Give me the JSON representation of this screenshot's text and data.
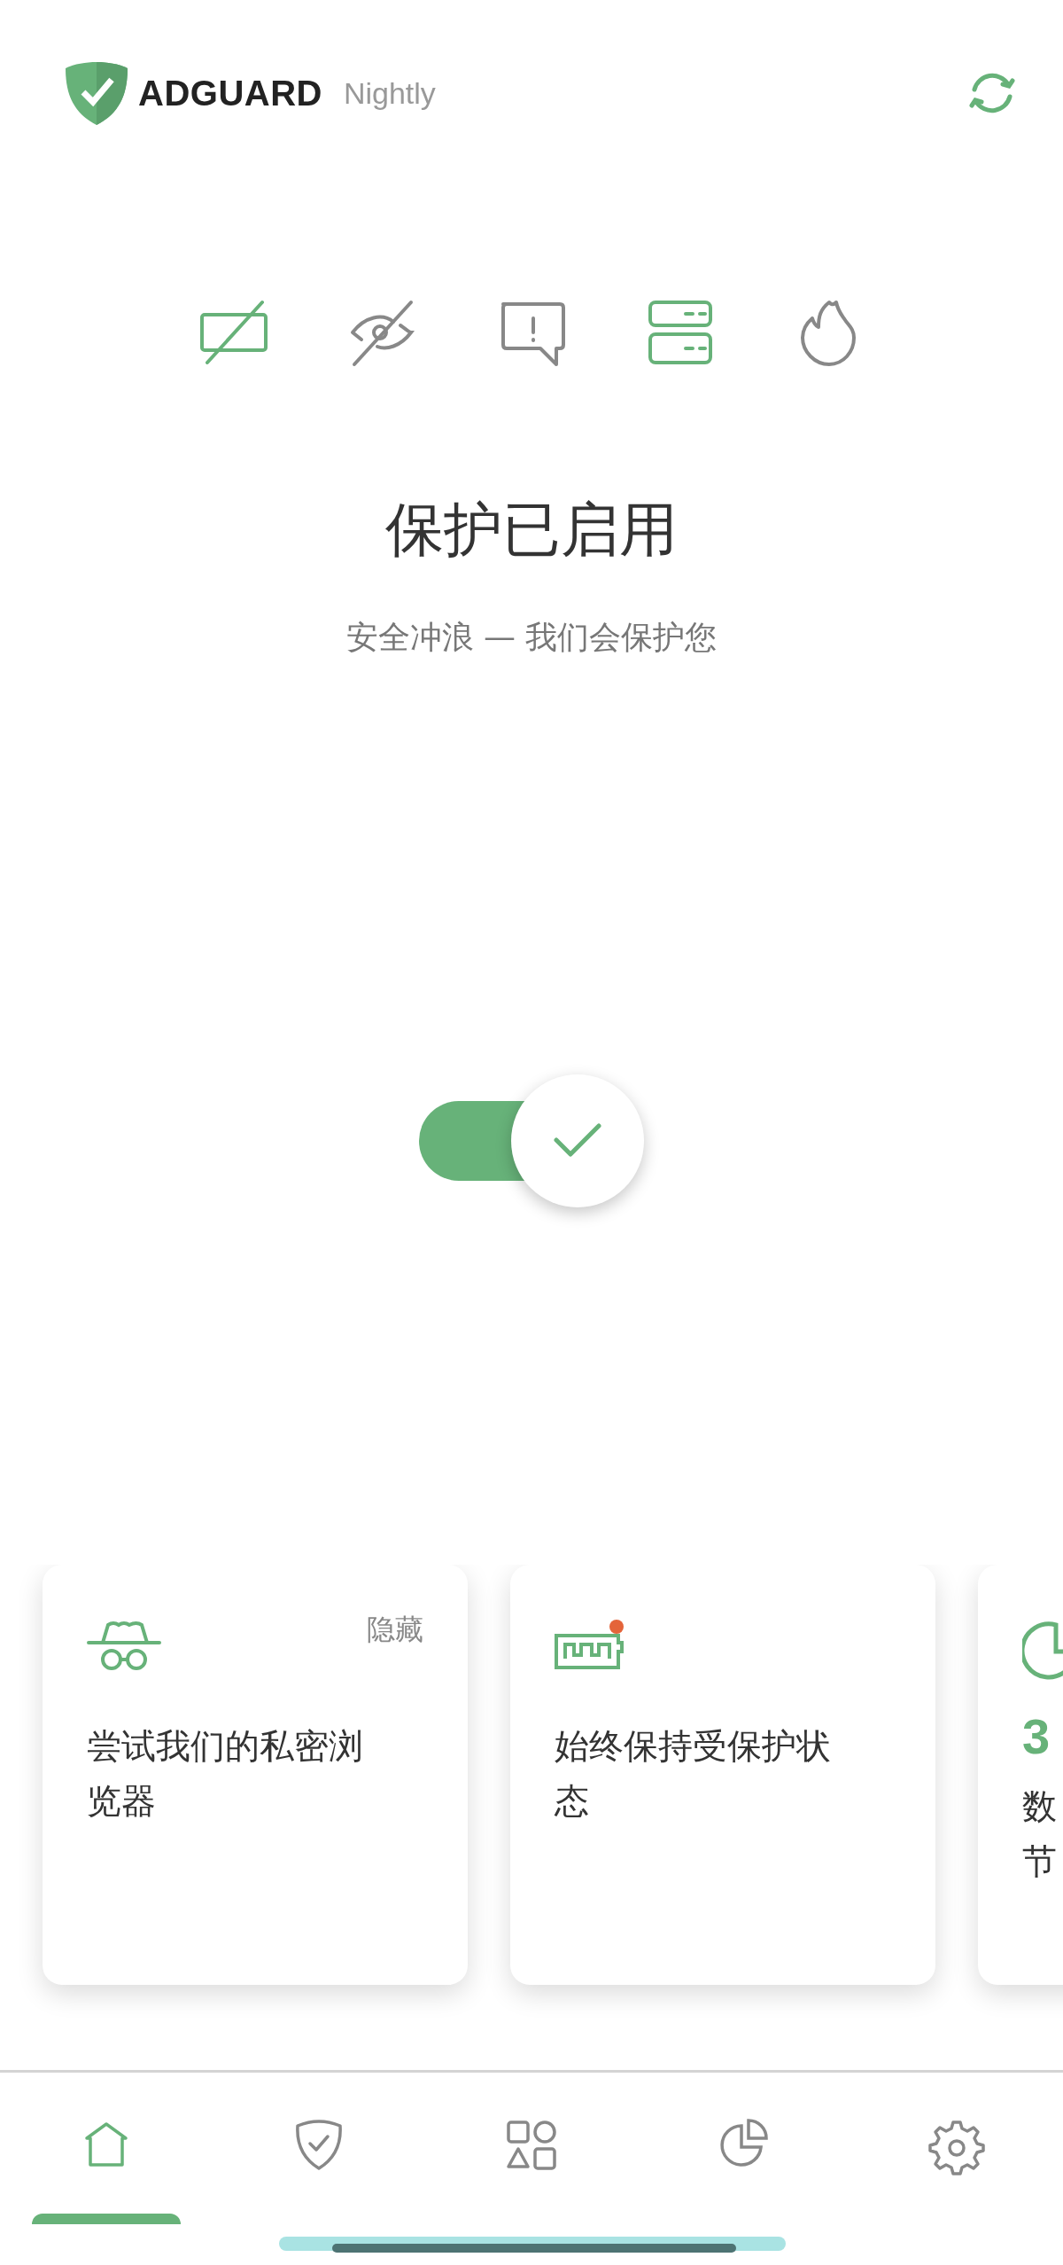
{
  "header": {
    "brand": "ADGUARD",
    "edition": "Nightly"
  },
  "feature_icons": [
    {
      "kind": "ads",
      "on": true
    },
    {
      "kind": "tracking",
      "on": false
    },
    {
      "kind": "annoyances",
      "on": false
    },
    {
      "kind": "dns",
      "on": true
    },
    {
      "kind": "firewall",
      "on": false
    }
  ],
  "status": {
    "title": "保护已启用",
    "subtitle": "安全冲浪 — 我们会保护您"
  },
  "protection_toggle": {
    "on": true
  },
  "cards": [
    {
      "kind": "browser",
      "action": "隐藏",
      "text": "尝试我们的私密浏览器"
    },
    {
      "kind": "battery",
      "color": "#e4643a",
      "text": "始终保持受保护状态"
    },
    {
      "kind": "stats",
      "value": "3",
      "lines": [
        "数",
        "节"
      ]
    }
  ],
  "bottom_nav": [
    {
      "kind": "home",
      "selected": true
    },
    {
      "kind": "protection",
      "selected": false
    },
    {
      "kind": "apps",
      "selected": false
    },
    {
      "kind": "statistics",
      "selected": false
    },
    {
      "kind": "settings",
      "selected": false
    }
  ]
}
